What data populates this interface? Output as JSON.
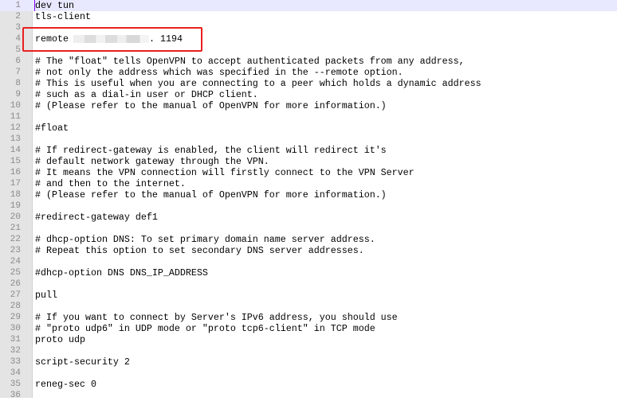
{
  "editor": {
    "current_line": 1,
    "lines": [
      "dev tun",
      "tls-client",
      "",
      "remote",
      "",
      "# The \"float\" tells OpenVPN to accept authenticated packets from any address,",
      "# not only the address which was specified in the --remote option.",
      "# This is useful when you are connecting to a peer which holds a dynamic address",
      "# such as a dial-in user or DHCP client.",
      "# (Please refer to the manual of OpenVPN for more information.)",
      "",
      "#float",
      "",
      "# If redirect-gateway is enabled, the client will redirect it's",
      "# default network gateway through the VPN.",
      "# It means the VPN connection will firstly connect to the VPN Server",
      "# and then to the internet.",
      "# (Please refer to the manual of OpenVPN for more information.)",
      "",
      "#redirect-gateway def1",
      "",
      "# dhcp-option DNS: To set primary domain name server address.",
      "# Repeat this option to set secondary DNS server addresses.",
      "",
      "#dhcp-option DNS DNS_IP_ADDRESS",
      "",
      "pull",
      "",
      "# If you want to connect by Server's IPv6 address, you should use",
      "# \"proto udp6\" in UDP mode or \"proto tcp6-client\" in TCP mode",
      "proto udp",
      "",
      "script-security 2",
      "",
      "reneg-sec 0",
      ""
    ],
    "remote_port_suffix": ". 1194",
    "highlight_color": "#e8211f"
  }
}
